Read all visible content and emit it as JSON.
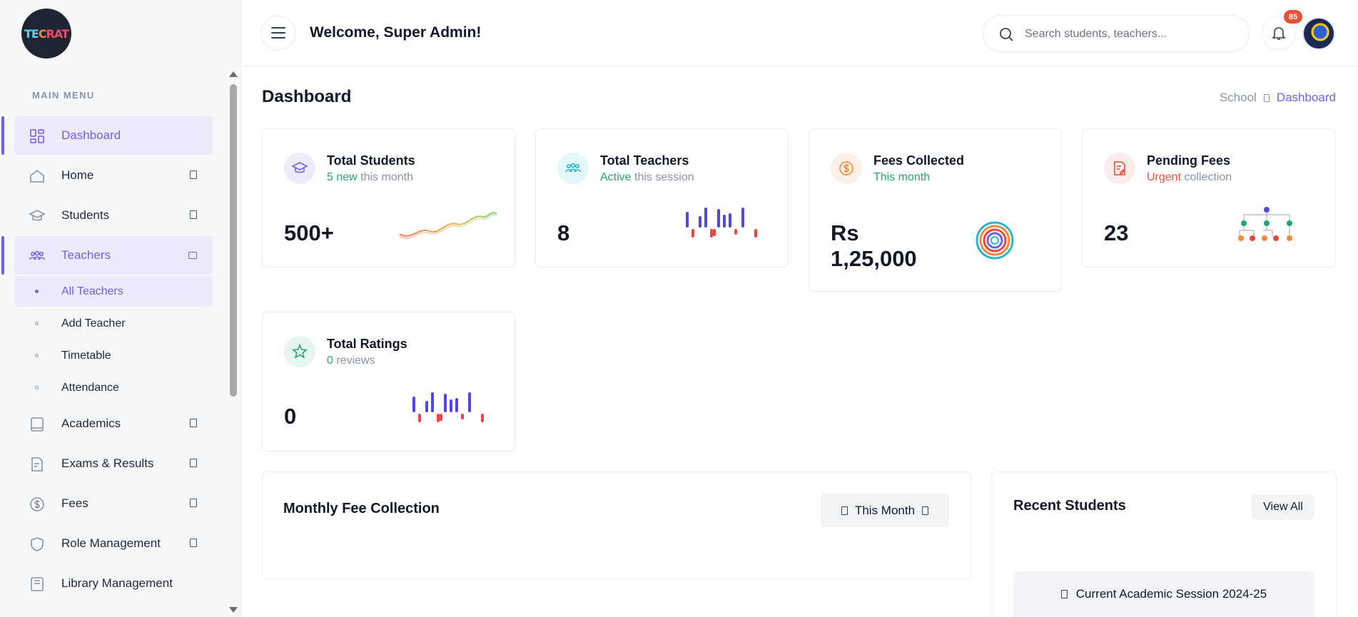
{
  "brand": {
    "logo_text_1": "TE",
    "logo_text_2": "C",
    "logo_text_3": "RAT"
  },
  "sidebar": {
    "section_title": "MAIN MENU",
    "items": [
      {
        "label": "Dashboard",
        "icon": "dashboard-icon",
        "active": true
      },
      {
        "label": "Home",
        "icon": "home-icon"
      },
      {
        "label": "Students",
        "icon": "graduation-cap-icon"
      },
      {
        "label": "Teachers",
        "icon": "users-icon",
        "open": true
      },
      {
        "label": "Academics",
        "icon": "book-icon"
      },
      {
        "label": "Exams & Results",
        "icon": "exam-icon"
      },
      {
        "label": "Fees",
        "icon": "dollar-icon"
      },
      {
        "label": "Role Management",
        "icon": "shield-icon"
      },
      {
        "label": "Library Management",
        "icon": "library-icon"
      }
    ],
    "teachers_sub": [
      {
        "label": "All Teachers",
        "active": true
      },
      {
        "label": "Add Teacher"
      },
      {
        "label": "Timetable"
      },
      {
        "label": "Attendance"
      }
    ]
  },
  "header": {
    "welcome": "Welcome, Super Admin!",
    "search_placeholder": "Search students, teachers...",
    "notification_count": "85"
  },
  "page": {
    "title": "Dashboard",
    "breadcrumb": [
      "School",
      "Dashboard"
    ]
  },
  "stats": [
    {
      "title": "Total Students",
      "sub_highlight": "5 new",
      "sub_rest": " this month",
      "value": "500+",
      "icon": "graduation-cap-icon",
      "accent": "#6f61e6"
    },
    {
      "title": "Total Teachers",
      "sub_highlight": "Active",
      "sub_rest": " this session",
      "value": "8",
      "icon": "users-icon",
      "accent": "#22b8cf"
    },
    {
      "title": "Fees Collected",
      "sub_highlight": "This month",
      "sub_rest": "",
      "value": "Rs 1,25,000",
      "icon": "dollar-icon",
      "accent": "#f2883a"
    },
    {
      "title": "Pending Fees",
      "sub_highlight": "Urgent",
      "sub_rest": " collection",
      "value": "23",
      "icon": "document-edit-icon",
      "accent": "#e8503a"
    },
    {
      "title": "Total Ratings",
      "sub_highlight": "0",
      "sub_rest": " reviews",
      "value": "0",
      "icon": "star-icon",
      "accent": "#1ea578"
    }
  ],
  "monthly_fee": {
    "title": "Monthly Fee Collection",
    "filter_label": "This Month"
  },
  "recent_students": {
    "title": "Recent Students",
    "view_all_label": "View All",
    "session_label": "Current Academic Session 2024-25"
  },
  "colors": {
    "primary": "#6f61e6",
    "success": "#1ea578",
    "danger": "#e8503a",
    "warning": "#f2883a",
    "info": "#22b8cf"
  }
}
